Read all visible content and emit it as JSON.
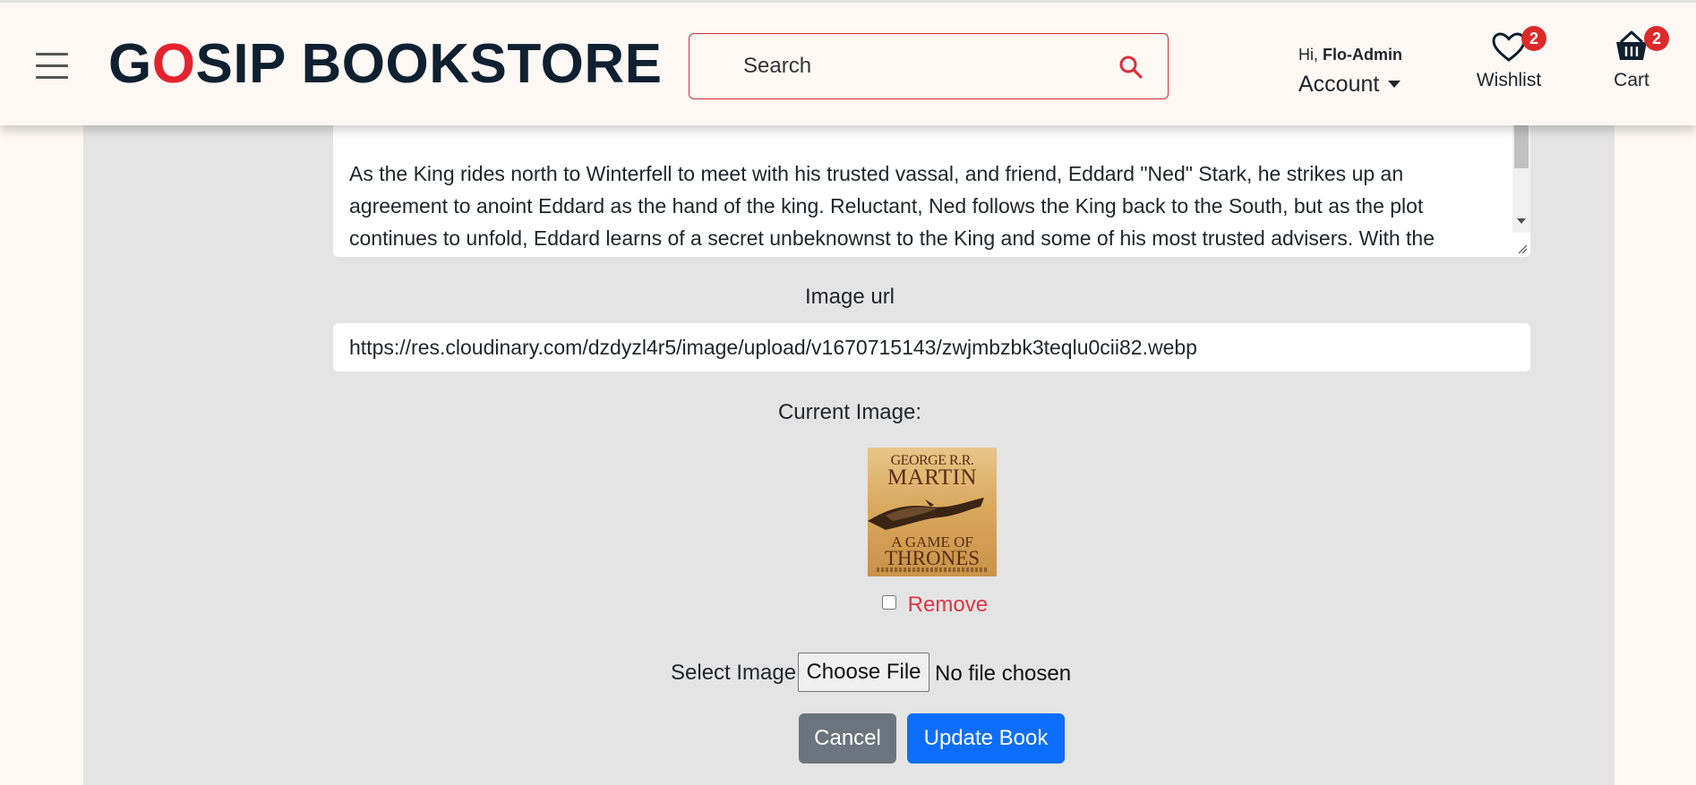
{
  "header": {
    "logo_g": "G",
    "logo_o": "O",
    "logo_rest": "SIP BOOKSTORE",
    "search_placeholder": "Search",
    "greeting_prefix": "Hi,",
    "username": "Flo-Admin",
    "account_label": "Account",
    "wishlist_label": "Wishlist",
    "wishlist_count": "2",
    "cart_label": "Cart",
    "cart_count": "2"
  },
  "form": {
    "description_text": "As the King rides north to Winterfell to meet with his trusted vassal, and friend, Eddard \"Ned\" Stark, he strikes up an agreement to anoint Eddard as the hand of the king. Reluctant, Ned follows the King back to the South, but as the plot continues to unfold, Eddard learns of a secret unbeknownst to the King and some of his most trusted advisers. With the",
    "image_url_label": "Image url",
    "image_url_value": "https://res.cloudinary.com/dzdyzl4r5/image/upload/v1670715143/zwjmbzbk3teqlu0cii82.webp",
    "current_image_label": "Current Image:",
    "cover": {
      "author_first": "GEORGE R.R.",
      "author_last": "MARTIN",
      "title_line1": "A GAME OF",
      "title_line2": "THRONES"
    },
    "remove_label": "Remove",
    "select_image_label": "Select Image",
    "choose_file_label": "Choose File",
    "no_file_text": "No file chosen",
    "cancel_label": "Cancel",
    "update_label": "Update Book"
  },
  "colors": {
    "brand_red": "#e4232e",
    "brand_dark": "#0f2030",
    "primary": "#0d6efd",
    "secondary": "#6c757d",
    "danger": "#dc3545",
    "panel_bg": "#e5e4e4",
    "page_bg": "#fdf8f4"
  },
  "icons": [
    "menu-icon",
    "search-icon",
    "heart-icon",
    "basket-icon",
    "caret-down-icon"
  ]
}
